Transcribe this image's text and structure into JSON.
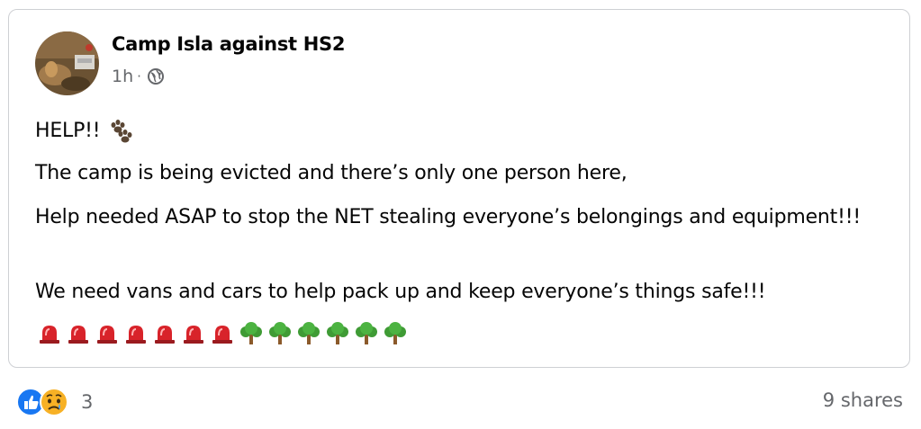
{
  "post": {
    "author": "Camp Isla against HS2",
    "time": "1h",
    "separator": "·",
    "audience_icon": "globe-icon",
    "lines": {
      "help": "HELP!!",
      "line2": "The camp is being evicted and there’s only one person here,",
      "line3": "Help needed ASAP to stop the NET stealing everyone’s belongings and equipment!!!",
      "line4": "We need vans and cars to help pack up and keep everyone’s things safe!!!"
    },
    "emoji_row": {
      "siren_count": 7,
      "tree_count": 6
    }
  },
  "footer": {
    "reaction_icons": [
      "like-icon",
      "sad-icon"
    ],
    "reaction_count": "3",
    "shares": "9 shares"
  },
  "colors": {
    "border": "#ced0d4",
    "secondary_text": "#65676b",
    "like_blue": "#1877f2",
    "sad_yellow": "#f7b125"
  }
}
